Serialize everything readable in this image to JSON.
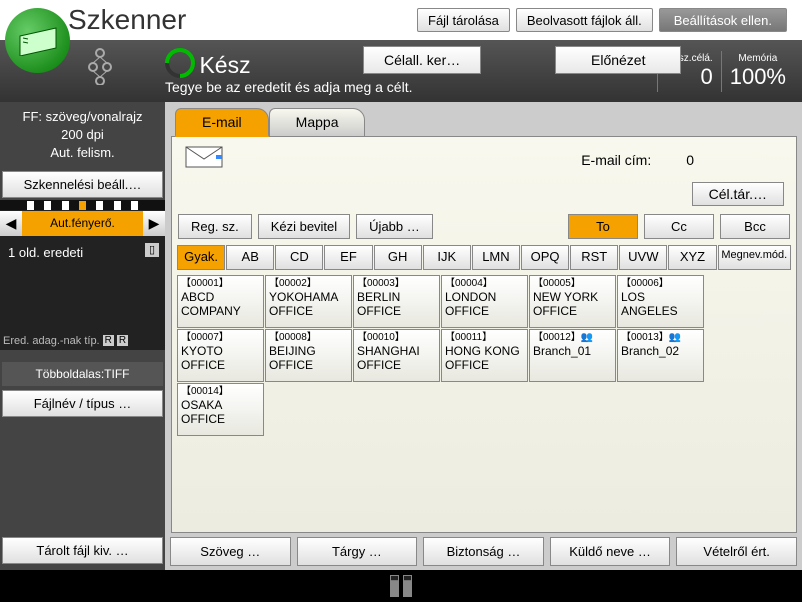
{
  "title": "Szkenner",
  "topButtons": {
    "saveFile": "Fájl tárolása",
    "scannedFiles": "Beolvasott fájlok áll.",
    "checkSettings": "Beállítások ellen."
  },
  "status": {
    "readyTitle": "Kész",
    "readySub": "Tegye be az eredetit és adja meg a célt.",
    "searchDest": "Célall. ker…",
    "preview": "Előnézet",
    "totalDest": {
      "label": "Össz.célá.",
      "value": "0"
    },
    "memory": {
      "label": "Memória",
      "value": "100%"
    }
  },
  "leftPanel": {
    "scanMode1": "FF: szöveg/vonalrajz",
    "scanMode2": "200 dpi",
    "scanMode3": "Aut. felism.",
    "scanSettings": "Szkennelési beáll.…",
    "autoDensity": "Aut.fényerő.",
    "preview": "1 old. eredeti",
    "eredType": "Ered. adag.-nak típ.",
    "multiPage": "Többoldalas:TIFF",
    "fileType": "Fájlnév / típus    …",
    "storedFile": "Tárolt fájl kiv.    …"
  },
  "tabs": {
    "email": "E-mail",
    "folder": "Mappa"
  },
  "emailArea": {
    "emailAddrLabel": "E-mail cím:",
    "emailAddrValue": "0",
    "destList": "Cél.tár.…"
  },
  "controlRow": {
    "regNo": "Reg. sz.",
    "manual": "Kézi bevitel",
    "new": "Újabb  …",
    "to": "To",
    "cc": "Cc",
    "bcc": "Bcc"
  },
  "alphaRow": [
    "Gyak.",
    "AB",
    "CD",
    "EF",
    "GH",
    "IJK",
    "LMN",
    "OPQ",
    "RST",
    "UVW",
    "XYZ",
    "Megnev.mód."
  ],
  "entries": [
    {
      "code": "【00001】",
      "name": "ABCD COMPANY"
    },
    {
      "code": "【00002】",
      "name": "YOKOHAMA OFFICE"
    },
    {
      "code": "【00003】",
      "name": "BERLIN OFFICE"
    },
    {
      "code": "【00004】",
      "name": "LONDON OFFICE"
    },
    {
      "code": "【00005】",
      "name": "NEW YORK OFFICE"
    },
    {
      "code": "【00006】",
      "name": "LOS ANGELES"
    },
    {
      "code": "【00007】",
      "name": "KYOTO OFFICE"
    },
    {
      "code": "【00008】",
      "name": "BEIJING OFFICE"
    },
    {
      "code": "【00010】",
      "name": "SHANGHAI OFFICE"
    },
    {
      "code": "【00011】",
      "name": "HONG KONG OFFICE"
    },
    {
      "code": "【00012】👥",
      "name": "Branch_01"
    },
    {
      "code": "【00013】👥",
      "name": "Branch_02"
    },
    {
      "code": "【00014】",
      "name": "OSAKA OFFICE"
    }
  ],
  "bottomButtons": {
    "text": "Szöveg        …",
    "subject": "Tárgy        …",
    "security": "Biztonság    …",
    "sender": "Küldő neve    …",
    "notify": "Vételről ért."
  }
}
